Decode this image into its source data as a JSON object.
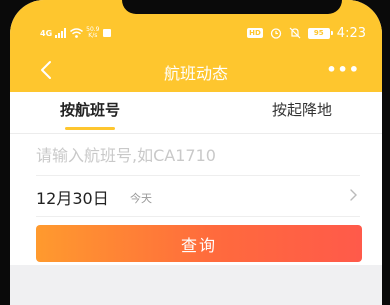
{
  "status_bar": {
    "signal": "4G",
    "net_speed_value": "50.9",
    "net_speed_unit": "K/s",
    "hd_label": "HD",
    "battery": "95",
    "time": "4:23"
  },
  "nav": {
    "title": "航班动态",
    "back_icon": "chevron-left-icon",
    "more_icon": "more-horizontal-icon",
    "more_label": "•••"
  },
  "tabs": [
    {
      "label": "按航班号",
      "active": true
    },
    {
      "label": "按起降地",
      "active": false
    }
  ],
  "form": {
    "flight_placeholder": "请输入航班号,如CA1710",
    "flight_value": "",
    "date": "12月30日",
    "date_hint": "今天",
    "query_button": "查询"
  },
  "colors": {
    "accent": "#fec62e",
    "button_start": "#ff9a2e",
    "button_end": "#ff5a4a"
  }
}
